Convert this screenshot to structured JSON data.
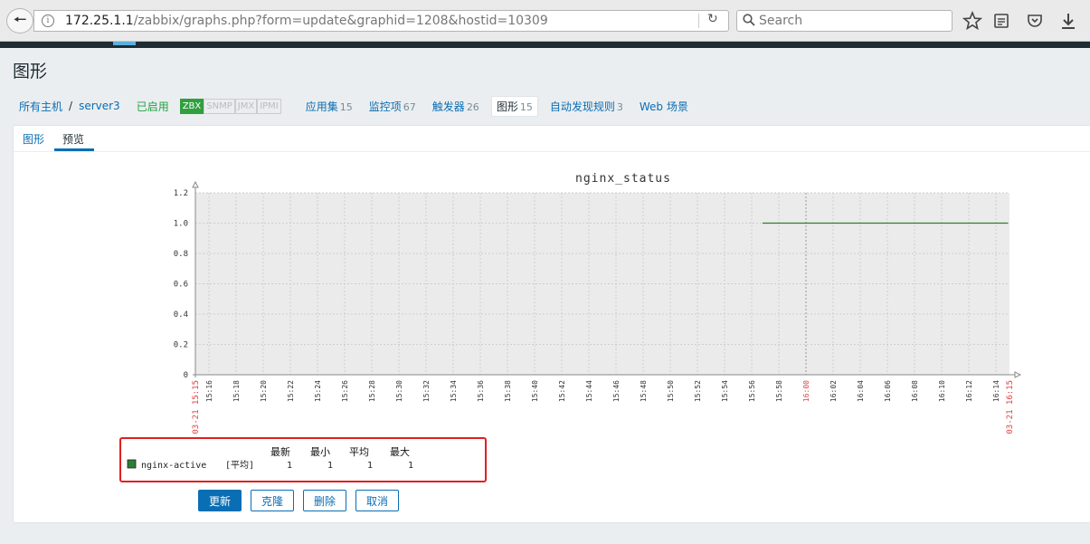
{
  "browser": {
    "url_host": "172.25.1.1",
    "url_path": "/zabbix/graphs.php?form=update&graphid=1208&hostid=10309",
    "search_placeholder": "Search"
  },
  "page": {
    "title": "图形"
  },
  "host_nav": {
    "all_hosts": "所有主机",
    "separator": "/",
    "host": "server3",
    "status": "已启用",
    "availability": [
      "ZBX",
      "SNMP",
      "JMX",
      "IPMI"
    ],
    "tabs": [
      {
        "label": "应用集",
        "count": "15"
      },
      {
        "label": "监控项",
        "count": "67"
      },
      {
        "label": "触发器",
        "count": "26"
      },
      {
        "label": "图形",
        "count": "15",
        "active": true
      },
      {
        "label": "自动发现规则",
        "count": "3"
      },
      {
        "label": "Web 场景",
        "count": ""
      }
    ]
  },
  "sub_tabs": [
    "图形",
    "预览"
  ],
  "chart_data": {
    "type": "line",
    "title": "nginx_status",
    "ylim": [
      0,
      1.2
    ],
    "y_ticks": [
      "1.2",
      "1.0",
      "0.8",
      "0.6",
      "0.4",
      "0.2",
      "0"
    ],
    "x_start_label": "03-21 15:15",
    "x_end_label": "03-21 16:15",
    "x_ticks": [
      "15:16",
      "15:18",
      "15:20",
      "15:22",
      "15:24",
      "15:26",
      "15:28",
      "15:30",
      "15:32",
      "15:34",
      "15:36",
      "15:38",
      "15:40",
      "15:42",
      "15:44",
      "15:46",
      "15:48",
      "15:50",
      "15:52",
      "15:54",
      "15:56",
      "15:58",
      "16:00",
      "16:02",
      "16:04",
      "16:06",
      "16:08",
      "16:10",
      "16:12",
      "16:14"
    ],
    "x_range_minutes": [
      0,
      60
    ],
    "series": [
      {
        "name": "nginx-active",
        "color": "#2e7d32",
        "x_start": "15:56",
        "x_end": "16:15",
        "value": 1
      }
    ],
    "legend": {
      "headers": [
        "最新",
        "最小",
        "平均",
        "最大"
      ],
      "rows": [
        {
          "name": "nginx-active",
          "func": "[平均]",
          "last": "1",
          "min": "1",
          "avg": "1",
          "max": "1"
        }
      ]
    }
  },
  "buttons": {
    "update": "更新",
    "clone": "克隆",
    "delete": "删除",
    "cancel": "取消"
  }
}
